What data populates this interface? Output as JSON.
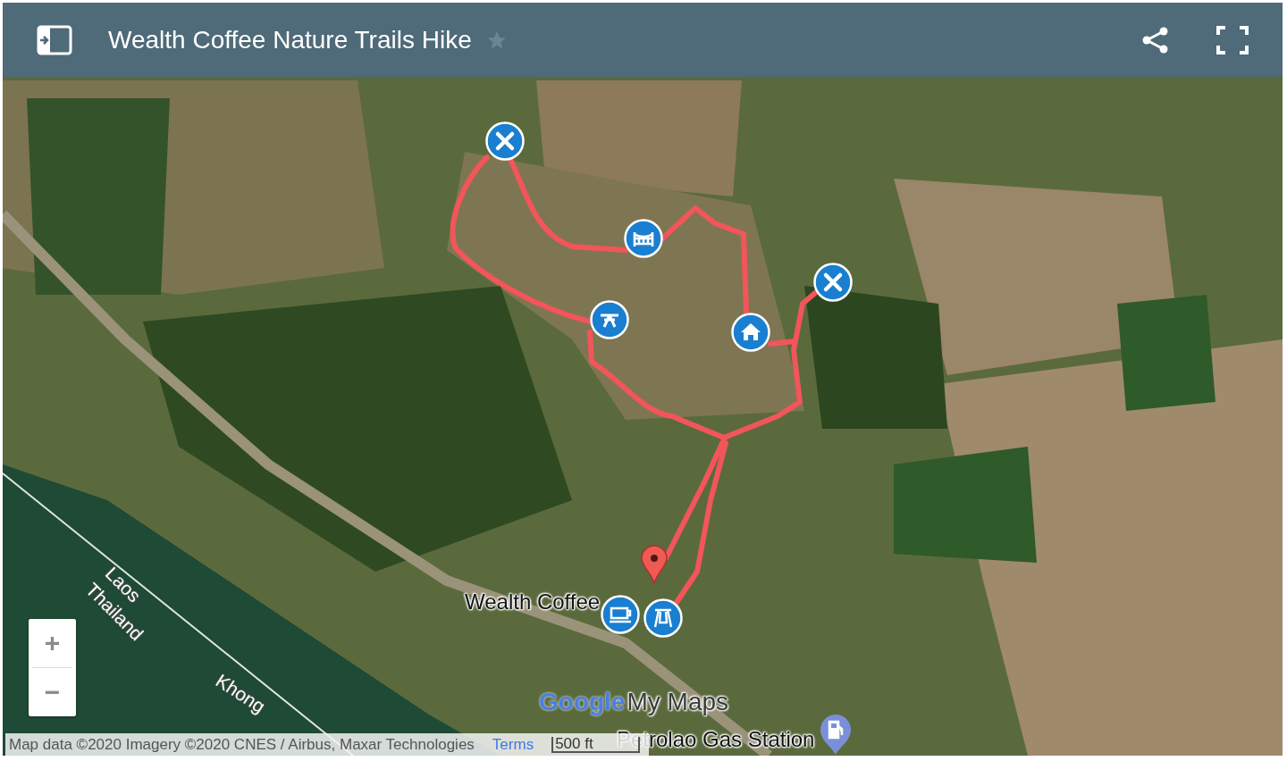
{
  "header": {
    "title": "Wealth Coffee Nature Trails Hike",
    "starred": false
  },
  "map": {
    "markers": [
      {
        "kind": "cross"
      },
      {
        "kind": "bridge"
      },
      {
        "kind": "picnic"
      },
      {
        "kind": "home"
      },
      {
        "kind": "cross"
      },
      {
        "kind": "cafe"
      },
      {
        "kind": "swing"
      },
      {
        "kind": "pin"
      },
      {
        "kind": "gas"
      }
    ],
    "labels": [
      {
        "kind": "place",
        "text": "Wealth Coffee"
      },
      {
        "kind": "border",
        "text": "Laos"
      },
      {
        "kind": "border",
        "text": "Thailand"
      },
      {
        "kind": "river",
        "text": "Khong"
      },
      {
        "kind": "place",
        "text": "Petrolao Gas Station"
      }
    ],
    "zoom_controls": [
      "+",
      "−"
    ],
    "logo": {
      "brand": "Google",
      "product": "My Maps"
    },
    "attribution": "Map data ©2020 Imagery ©2020 CNES / Airbus, Maxar Technologies",
    "terms_link": "Terms",
    "scale": "500 ft"
  }
}
